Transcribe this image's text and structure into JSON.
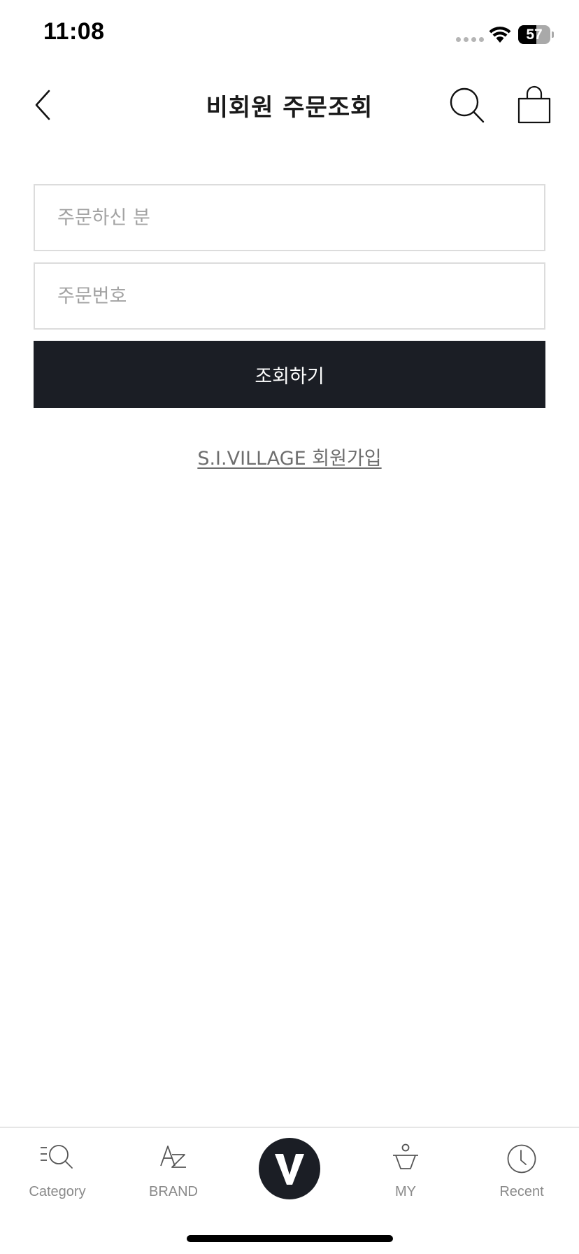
{
  "status_bar": {
    "time": "11:08",
    "battery_level": "57"
  },
  "header": {
    "title": "비회원 주문조회"
  },
  "form": {
    "orderer_field": {
      "placeholder": "주문하신 분",
      "value": ""
    },
    "order_number_field": {
      "placeholder": "주문번호",
      "value": ""
    },
    "submit_label": "조회하기",
    "signup_link": "S.I.VILLAGE 회원가입"
  },
  "bottom_nav": {
    "items": [
      {
        "label": "Category",
        "icon": "category-search-icon"
      },
      {
        "label": "BRAND",
        "icon": "brand-az-icon"
      },
      {
        "label": "",
        "icon": "v-logo-icon"
      },
      {
        "label": "MY",
        "icon": "my-person-icon"
      },
      {
        "label": "Recent",
        "icon": "clock-icon"
      }
    ]
  },
  "colors": {
    "primary_button": "#1b1e25",
    "placeholder": "#a3a3a3",
    "input_border": "#dcdcdc",
    "nav_label": "#8a8a8a",
    "link": "#6e6e6e"
  }
}
